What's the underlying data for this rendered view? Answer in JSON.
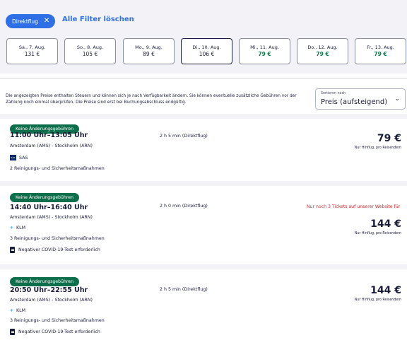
{
  "filters": {
    "chip_label": "Direktflug",
    "chip_close": "✕",
    "clear_all": "Alle Filter löschen"
  },
  "dates": [
    {
      "day": "Sa., 7. Aug.",
      "price": "131 €",
      "cheap": false,
      "selected": false
    },
    {
      "day": "So., 8. Aug.",
      "price": "105 €",
      "cheap": false,
      "selected": false
    },
    {
      "day": "Mo., 9. Aug.",
      "price": "89 €",
      "cheap": false,
      "selected": false
    },
    {
      "day": "Di., 10. Aug.",
      "price": "106 €",
      "cheap": false,
      "selected": true
    },
    {
      "day": "Mi., 11. Aug.",
      "price": "79 €",
      "cheap": true,
      "selected": false
    },
    {
      "day": "Do., 12. Aug.",
      "price": "79 €",
      "cheap": true,
      "selected": false
    },
    {
      "day": "Fr., 13. Aug.",
      "price": "79 €",
      "cheap": true,
      "selected": false
    }
  ],
  "info_text": "Die angezeigten Preise enthalten Steuern und können sich je nach Verfügbarkeit ändern. Sie können eventuelle zusätzliche Gebühren vor der Zahlung noch einmal überprüfen. Die Preise sind erst bei Buchungsabschluss endgültig.",
  "sort": {
    "label": "Sortieren nach",
    "value": "Preis (aufsteigend)",
    "chevron": "⌄"
  },
  "colors": {
    "accent": "#2f6fe6",
    "badge": "#0c6e4a",
    "cheap": "#0c7a4b",
    "warning": "#d22b2b",
    "text": "#1a1d3b"
  },
  "results": [
    {
      "badge": "Keine Änderungsgebühren",
      "times": "11:00 Uhr–13:05 Uhr",
      "route": "Amsterdam (AMS) - Stockholm (ARN)",
      "airline": "SAS",
      "airline_icon": "sas-logo-icon",
      "measures": "2 Reinigungs- und Sicherheitsmaßnahmen",
      "covid": "",
      "duration": "2 h 5 min (Direktflug)",
      "warning": "",
      "price": "79 €",
      "per": "Nur Hinflug, pro Reisendem"
    },
    {
      "badge": "Keine Änderungsgebühren",
      "times": "14:40 Uhr–16:40 Uhr",
      "route": "Amsterdam (AMS) - Stockholm (ARN)",
      "airline": "KLM",
      "airline_icon": "klm-logo-icon",
      "measures": "3 Reinigungs- und Sicherheitsmaßnahmen",
      "covid": "Negativer COVID-19-Test erforderlich",
      "duration": "2 h 0 min (Direktflug)",
      "warning": "Nur noch 3 Tickets auf unserer Website für",
      "price": "144 €",
      "per": "Nur Hinflug, pro Reisendem"
    },
    {
      "badge": "Keine Änderungsgebühren",
      "times": "20:50 Uhr–22:55 Uhr",
      "route": "Amsterdam (AMS) - Stockholm (ARN)",
      "airline": "KLM",
      "airline_icon": "klm-logo-icon",
      "measures": "3 Reinigungs- und Sicherheitsmaßnahmen",
      "covid": "Negativer COVID-19-Test erforderlich",
      "duration": "2 h 5 min (Direktflug)",
      "warning": "",
      "price": "144 €",
      "per": "Nur Hinflug, pro Reisendem"
    }
  ]
}
